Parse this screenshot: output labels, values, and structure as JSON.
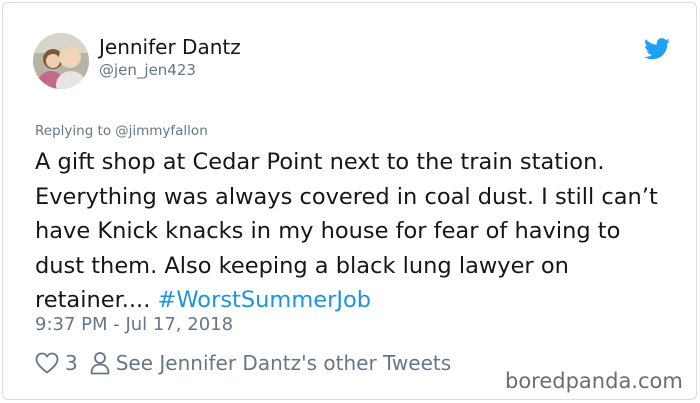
{
  "tweet": {
    "author": {
      "name": "Jennifer Dantz",
      "handle": "@jen_jen423",
      "avatar_icon": "profile-photo"
    },
    "platform_icon": "twitter-bird-icon",
    "reply": {
      "prefix": "Replying to",
      "target": "@jimmyfallon"
    },
    "text": "A gift shop at Cedar Point next to the train station. Everything was always covered in coal dust. I still can’t have Knick knacks in my house for fear of having to dust them. Also keeping a black lung lawyer on retainer....",
    "hashtag": "#WorstSummerJob",
    "timestamp": "9:37 PM - Jul 17, 2018",
    "likes": "3",
    "other_tweets_link": "See Jennifer Dantz's other Tweets"
  },
  "watermark": "boredpanda.com",
  "colors": {
    "link": "#1b95e0",
    "secondary_text": "#657786",
    "primary_text": "#14171a",
    "twitter_blue": "#1da1f2",
    "border": "#d6dde3"
  }
}
